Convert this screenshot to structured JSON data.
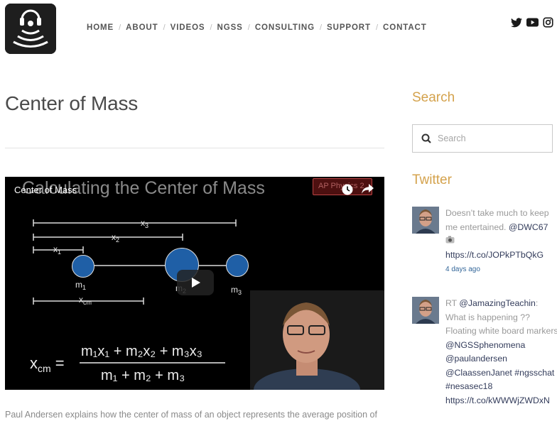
{
  "header": {
    "logo_icon": "headphones-signal-logo-icon",
    "nav": [
      "HOME",
      "ABOUT",
      "VIDEOS",
      "NGSS",
      "CONSULTING",
      "SUPPORT",
      "CONTACT"
    ],
    "social": [
      "twitter-icon",
      "youtube-icon",
      "instagram-icon"
    ]
  },
  "main": {
    "title": "Center of Mass",
    "video": {
      "slide_title": "Calculating the Center of Mass",
      "youtube_title": "Center of Mass",
      "badge": "AP Physics 2",
      "labels": {
        "x3": "x",
        "x3_sub": "3",
        "x2": "x",
        "x2_sub": "2",
        "x1": "x",
        "x1_sub": "1",
        "m1": "m",
        "m1_sub": "1",
        "m2": "m",
        "m2_sub": "2",
        "m3": "m",
        "m3_sub": "3",
        "xcm": "x",
        "xcm_sub": "cm"
      },
      "formula_lhs": "x",
      "formula_lhs_sub": "cm",
      "formula_num": "m₁x₁ + m₂x₂ + m₃x₃",
      "formula_den": "m₁ + m₂ + m₃"
    },
    "description": "Paul Andersen explains how the center of mass of an object represents the average position of"
  },
  "sidebar": {
    "search_heading": "Search",
    "search_placeholder": "Search",
    "twitter_heading": "Twitter",
    "tweets": [
      {
        "text": "Doesn’t take much to keep me entertained. ",
        "mention": "@DWC67",
        "link": "https://t.co/JOPkPTbQkG",
        "time": "4 days ago"
      },
      {
        "prefix": "RT ",
        "mention": "@JamazingTeachin",
        "text": ": What is happening ?? Floating white board markers",
        "mentions2": [
          "@NGSSphenomena",
          "@paulandersen",
          "@ClaassenJanet"
        ],
        "hashtags": [
          "#ngsschat",
          "#nesasec18"
        ],
        "link": "https://t.co/kWWWjZWDxN"
      }
    ]
  },
  "colors": {
    "accent": "#d4a24c",
    "link": "#333c5b",
    "time": "#336699"
  }
}
